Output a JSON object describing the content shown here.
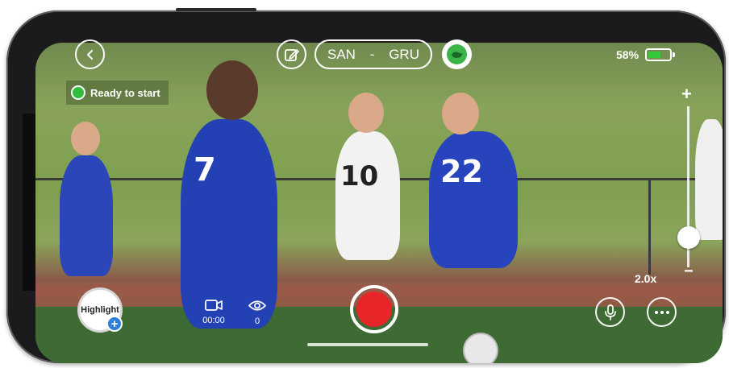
{
  "header": {
    "back_icon": "chevron-left-icon",
    "edit_icon": "edit-icon",
    "home_team": "SAN",
    "separator": "-",
    "away_team": "GRU",
    "team_color_icon": "jersey-icon",
    "battery_percent": "58%",
    "battery_level": 0.58,
    "battery_color": "#35c93a"
  },
  "status": {
    "text": "Ready to start",
    "color": "#2fbf3c"
  },
  "zoom": {
    "plus": "+",
    "minus": "−",
    "label": "2.0x",
    "level": 0.2
  },
  "bottom": {
    "highlight_label": "Highlight",
    "highlight_add": "+",
    "video_icon": "video-camera-icon",
    "duration": "00:00",
    "viewers_icon": "eye-icon",
    "viewers": "0",
    "record_color": "#e8262a",
    "mic_icon": "microphone-icon",
    "more_icon": "more-dots-icon"
  }
}
